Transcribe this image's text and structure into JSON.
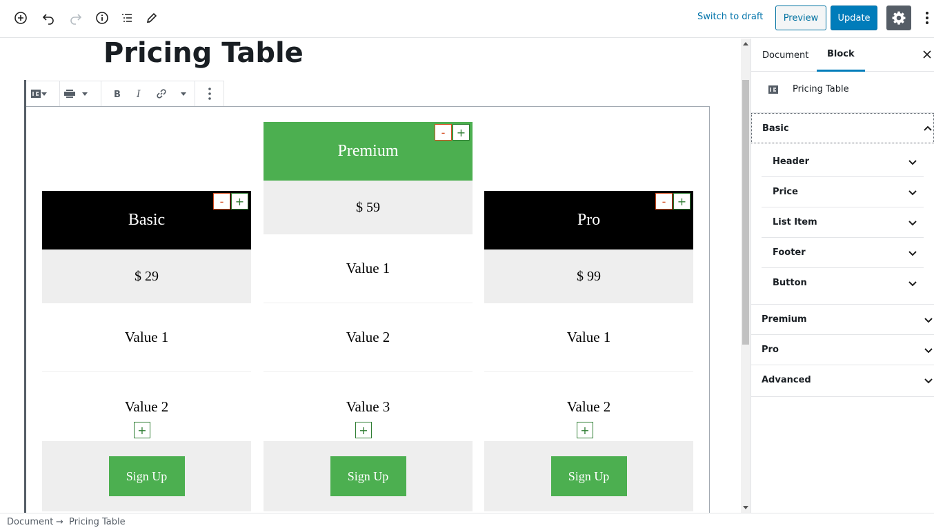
{
  "toolbar": {
    "switch_to_draft": "Switch to draft",
    "preview": "Preview",
    "update": "Update"
  },
  "editor": {
    "post_title": "Pricing Table"
  },
  "pricing_table": {
    "columns": [
      {
        "header": "Basic",
        "header_color": "#000000",
        "price": "$ 29",
        "items": [
          "Value 1",
          "Value 2"
        ],
        "button": "Sign Up"
      },
      {
        "header": "Premium",
        "header_color": "#4caf50",
        "price": "$ 59",
        "items": [
          "Value 1",
          "Value 2",
          "Value 3"
        ],
        "button": "Sign Up"
      },
      {
        "header": "Pro",
        "header_color": "#000000",
        "price": "$ 99",
        "items": [
          "Value 1",
          "Value 2"
        ],
        "button": "Sign Up"
      }
    ],
    "minus": "-",
    "plus": "+"
  },
  "sidebar": {
    "tabs": [
      "Document",
      "Block"
    ],
    "block_name": "Pricing Table",
    "panels": {
      "basic": "Basic",
      "basic_sub": [
        "Header",
        "Price",
        "List Item",
        "Footer",
        "Button"
      ],
      "premium": "Premium",
      "pro": "Pro",
      "advanced": "Advanced"
    }
  },
  "breadcrumb": {
    "root": "Document",
    "separator": "→",
    "current": "Pricing Table"
  },
  "colors": {
    "accent": "#007cba",
    "signup_green": "#4caf50",
    "cell_gray": "#eeeeee"
  }
}
